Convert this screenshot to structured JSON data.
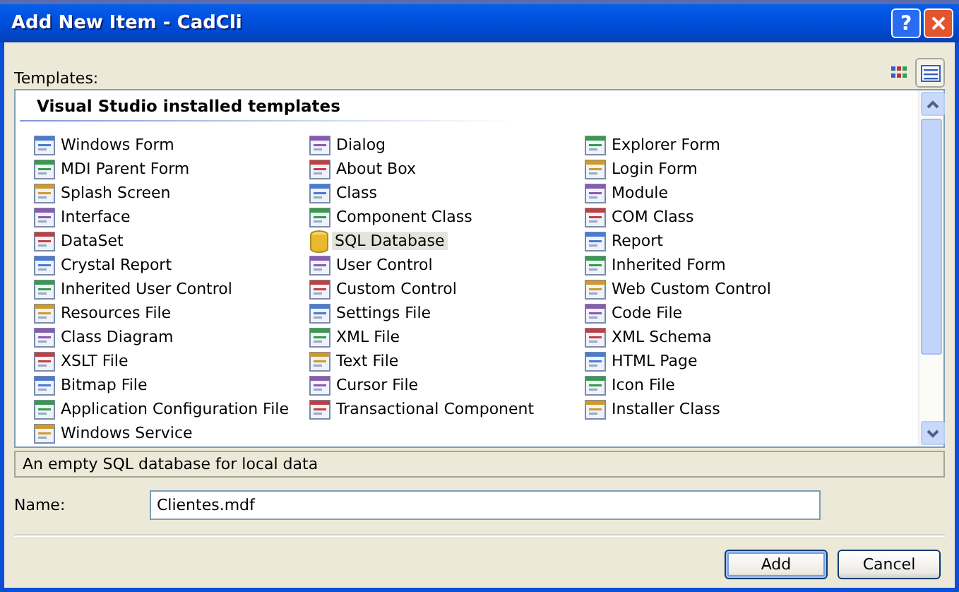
{
  "window": {
    "title": "Add New Item - CadCli",
    "help_button": "?"
  },
  "templates_label": "Templates:",
  "view_buttons": [
    {
      "kind": "large",
      "selected": false
    },
    {
      "kind": "small",
      "selected": true
    }
  ],
  "group_header": "Visual Studio installed templates",
  "columns": [
    [
      {
        "label": "Windows Form",
        "selected": false
      },
      {
        "label": "MDI Parent Form",
        "selected": false
      },
      {
        "label": "Splash Screen",
        "selected": false
      },
      {
        "label": "Interface",
        "selected": false
      },
      {
        "label": "DataSet",
        "selected": false
      },
      {
        "label": "Crystal Report",
        "selected": false
      },
      {
        "label": "Inherited User Control",
        "selected": false
      },
      {
        "label": "Resources File",
        "selected": false
      },
      {
        "label": "Class Diagram",
        "selected": false
      },
      {
        "label": "XSLT File",
        "selected": false
      },
      {
        "label": "Bitmap File",
        "selected": false
      },
      {
        "label": "Application Configuration File",
        "selected": false
      },
      {
        "label": "Windows Service",
        "selected": false
      }
    ],
    [
      {
        "label": "Dialog",
        "selected": false
      },
      {
        "label": "About Box",
        "selected": false
      },
      {
        "label": "Class",
        "selected": false
      },
      {
        "label": "Component Class",
        "selected": false
      },
      {
        "label": "SQL Database",
        "selected": true
      },
      {
        "label": "User Control",
        "selected": false
      },
      {
        "label": "Custom Control",
        "selected": false
      },
      {
        "label": "Settings File",
        "selected": false
      },
      {
        "label": "XML File",
        "selected": false
      },
      {
        "label": "Text File",
        "selected": false
      },
      {
        "label": "Cursor File",
        "selected": false
      },
      {
        "label": "Transactional Component",
        "selected": false
      }
    ],
    [
      {
        "label": "Explorer Form",
        "selected": false
      },
      {
        "label": "Login Form",
        "selected": false
      },
      {
        "label": "Module",
        "selected": false
      },
      {
        "label": "COM Class",
        "selected": false
      },
      {
        "label": "Report",
        "selected": false
      },
      {
        "label": "Inherited Form",
        "selected": false
      },
      {
        "label": "Web Custom Control",
        "selected": false
      },
      {
        "label": "Code File",
        "selected": false
      },
      {
        "label": "XML Schema",
        "selected": false
      },
      {
        "label": "HTML Page",
        "selected": false
      },
      {
        "label": "Icon File",
        "selected": false
      },
      {
        "label": "Installer Class",
        "selected": false
      }
    ]
  ],
  "description": "An empty SQL database for local data",
  "name_field": {
    "label": "Name:",
    "value": "Clientes.mdf"
  },
  "buttons": [
    "Add",
    "Cancel"
  ]
}
